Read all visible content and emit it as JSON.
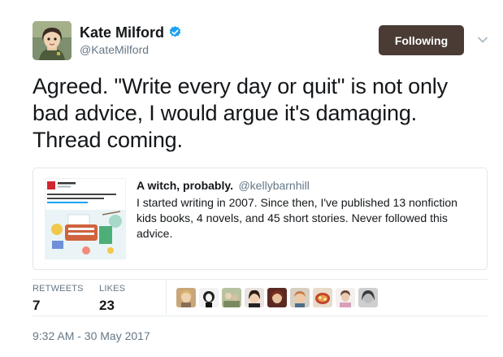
{
  "author": {
    "display_name": "Kate Milford",
    "handle": "@KateMilford",
    "verified": true,
    "avatar_icon": "avatar-illustration-icon"
  },
  "follow_button": {
    "label": "Following",
    "color": "#4a3b35"
  },
  "tweet": {
    "text": "Agreed. \"Write every day or quit\" is not only bad advice, I would argue it's damaging. Thread coming."
  },
  "quoted_tweet": {
    "display_name": "A witch, probably.",
    "handle": "@kellybarnhill",
    "text": "I started writing in 2007. Since then, I've published 13 nonfiction kids books, 4 novels, and 45 short stories. Never followed this advice.",
    "thumbnail_icon": "daily-beast-typewriter-thumbnail"
  },
  "stats": {
    "retweets_label": "RETWEETS",
    "retweets_value": "7",
    "likes_label": "LIKES",
    "likes_value": "23"
  },
  "likers": [
    {
      "name": "liker-avatar-1"
    },
    {
      "name": "liker-avatar-2"
    },
    {
      "name": "liker-avatar-3"
    },
    {
      "name": "liker-avatar-4"
    },
    {
      "name": "liker-avatar-5"
    },
    {
      "name": "liker-avatar-6"
    },
    {
      "name": "liker-avatar-7"
    },
    {
      "name": "liker-avatar-8"
    },
    {
      "name": "liker-avatar-9"
    }
  ],
  "timestamp": "9:32 AM - 30 May 2017",
  "colors": {
    "verified_blue": "#1da1f2",
    "secondary_text": "#657786",
    "border": "#e1e8ed"
  }
}
